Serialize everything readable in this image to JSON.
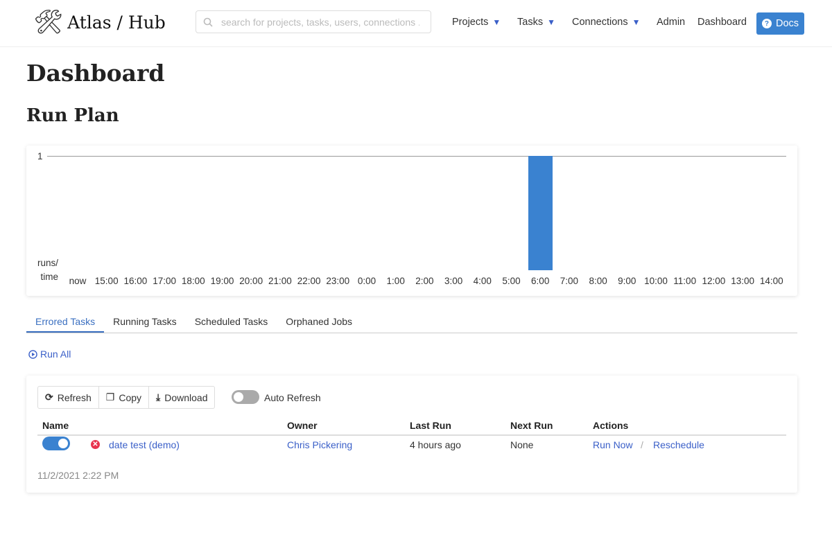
{
  "header": {
    "brand": "Atlas / Hub",
    "search_placeholder": "search for projects, tasks, users, connections ..",
    "menu": [
      {
        "label": "Projects",
        "dropdown": true
      },
      {
        "label": "Tasks",
        "dropdown": true
      },
      {
        "label": "Connections",
        "dropdown": true
      },
      {
        "label": "Admin"
      },
      {
        "label": "Dashboard"
      }
    ],
    "docs_label": "Docs"
  },
  "page_title": "Dashboard",
  "section_title": "Run Plan",
  "chart_data": {
    "type": "bar",
    "ylabel": "runs/\ntime",
    "y_ticks": [
      "1"
    ],
    "ylim": [
      0,
      1
    ],
    "categories": [
      "now",
      "15:00",
      "16:00",
      "17:00",
      "18:00",
      "19:00",
      "20:00",
      "21:00",
      "22:00",
      "23:00",
      "0:00",
      "1:00",
      "2:00",
      "3:00",
      "4:00",
      "5:00",
      "6:00",
      "7:00",
      "8:00",
      "9:00",
      "10:00",
      "11:00",
      "12:00",
      "13:00",
      "14:00"
    ],
    "values": [
      0,
      0,
      0,
      0,
      0,
      0,
      0,
      0,
      0,
      0,
      0,
      0,
      0,
      0,
      0,
      0,
      1,
      0,
      0,
      0,
      0,
      0,
      0,
      0,
      0
    ],
    "color": "#3a82d0"
  },
  "tabs": [
    {
      "label": "Errored Tasks",
      "active": true
    },
    {
      "label": "Running Tasks"
    },
    {
      "label": "Scheduled Tasks"
    },
    {
      "label": "Orphaned Jobs"
    }
  ],
  "run_all": "Run All",
  "toolbar": {
    "refresh": "Refresh",
    "copy": "Copy",
    "download": "Download",
    "auto_refresh": "Auto Refresh",
    "auto_refresh_on": false
  },
  "table": {
    "headers": [
      "Name",
      "Owner",
      "Last Run",
      "Next Run",
      "Actions"
    ],
    "rows": [
      {
        "enabled": true,
        "status": "error",
        "name": "date test (demo)",
        "owner": "Chris Pickering",
        "last_run": "4 hours ago",
        "next_run": "None",
        "action1": "Run Now",
        "separator": "/",
        "action2": "Reschedule"
      }
    ]
  },
  "footer_timestamp": "11/2/2021 2:22 PM"
}
